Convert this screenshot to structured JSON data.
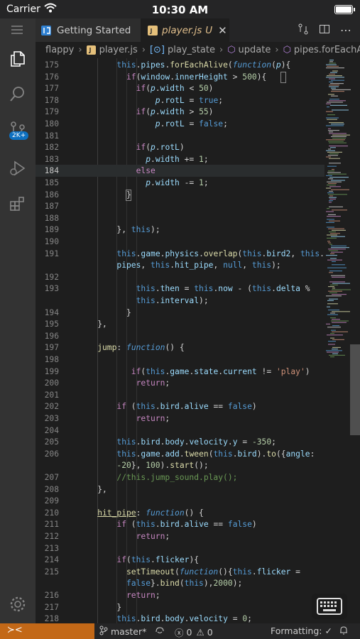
{
  "ios_status": {
    "carrier": "Carrier",
    "time": "10:30 AM"
  },
  "activity": {
    "scm_badge": "2K+"
  },
  "tabs": [
    {
      "label": "Getting Started"
    },
    {
      "label": "player.js",
      "status": "U"
    }
  ],
  "breadcrumb": [
    "flappy",
    "player.js",
    "play_state",
    "update",
    "pipes.forEachAlive()"
  ],
  "status": {
    "branch": "master*",
    "errors": "0",
    "warnings": "0",
    "formatting": "Formatting:"
  },
  "code_lines": [
    {
      "n": "175",
      "h": "<span class=\"k\">this</span><span class=\"t\">.</span><span class=\"p\">pipes</span><span class=\"t\">.</span><span class=\"f\">forEachAlive</span><span class=\"t\">(</span><span class=\"fn\">function</span><span class=\"t\">(</span><span class=\"pm\">p</span><span class=\"t\">){</span>",
      "i": 8
    },
    {
      "n": "176",
      "h": "<span class=\"ctrl\">if</span><span class=\"t\">(</span><span class=\"p\">window</span><span class=\"t\">.</span><span class=\"p\">innerHeight</span><span class=\"t\"> &gt; </span><span class=\"n\">500</span><span class=\"t\">){</span>",
      "i": 10
    },
    {
      "n": "177",
      "h": "<span class=\"ctrl\">if</span><span class=\"t\">(</span><span class=\"pm\">p</span><span class=\"t\">.</span><span class=\"p\">width</span><span class=\"t\"> &lt; </span><span class=\"n\">50</span><span class=\"t\">)</span>",
      "i": 12
    },
    {
      "n": "178",
      "h": "<span class=\"pm\">p</span><span class=\"t\">.</span><span class=\"p\">rotL</span><span class=\"t\"> = </span><span class=\"k\">true</span><span class=\"t\">;</span>",
      "i": 16
    },
    {
      "n": "179",
      "h": "<span class=\"ctrl\">if</span><span class=\"t\">(</span><span class=\"pm\">p</span><span class=\"t\">.</span><span class=\"p\">width</span><span class=\"t\"> &gt; </span><span class=\"n\">55</span><span class=\"t\">)</span>",
      "i": 12
    },
    {
      "n": "180",
      "h": "<span class=\"pm\">p</span><span class=\"t\">.</span><span class=\"p\">rotL</span><span class=\"t\"> = </span><span class=\"k\">false</span><span class=\"t\">;</span>",
      "i": 16
    },
    {
      "n": "181",
      "h": "",
      "i": 0
    },
    {
      "n": "182",
      "h": "<span class=\"ctrl\">if</span><span class=\"t\">(</span><span class=\"pm\">p</span><span class=\"t\">.</span><span class=\"p\">rotL</span><span class=\"t\">)</span>",
      "i": 12
    },
    {
      "n": "183",
      "h": "<span class=\"pm\">p</span><span class=\"t\">.</span><span class=\"p\">width</span><span class=\"t\"> += </span><span class=\"n\">1</span><span class=\"t\">;</span>",
      "i": 14
    },
    {
      "n": "184",
      "h": "<span class=\"ctrl\">else</span>",
      "i": 12,
      "cur": true
    },
    {
      "n": "185",
      "h": "<span class=\"pm\">p</span><span class=\"t\">.</span><span class=\"p\">width</span><span class=\"t\"> -= </span><span class=\"n\">1</span><span class=\"t\">;</span>",
      "i": 14
    },
    {
      "n": "186",
      "h": "<span class=\"t\">}</span>",
      "i": 10
    },
    {
      "n": "187",
      "h": "",
      "i": 0
    },
    {
      "n": "188",
      "h": "",
      "i": 0
    },
    {
      "n": "189",
      "h": "<span class=\"t\">}, </span><span class=\"k\">this</span><span class=\"t\">);</span>",
      "i": 8
    },
    {
      "n": "190",
      "h": "",
      "i": 0
    },
    {
      "n": "191",
      "h": "<span class=\"k\">this</span><span class=\"t\">.</span><span class=\"p\">game</span><span class=\"t\">.</span><span class=\"p\">physics</span><span class=\"t\">.</span><span class=\"f\">overlap</span><span class=\"t\">(</span><span class=\"k\">this</span><span class=\"t\">.</span><span class=\"p\">bird2</span><span class=\"t\">, </span><span class=\"k\">this</span><span class=\"t\">.</span>",
      "i": 8
    },
    {
      "n": "",
      "h": "<span class=\"p\">pipes</span><span class=\"t\">, </span><span class=\"k\">this</span><span class=\"t\">.</span><span class=\"p\">hit_pipe</span><span class=\"t\">, </span><span class=\"k\">null</span><span class=\"t\">, </span><span class=\"k\">this</span><span class=\"t\">);</span>",
      "i": 8
    },
    {
      "n": "192",
      "h": "",
      "i": 0
    },
    {
      "n": "193",
      "h": "<span class=\"k\">this</span><span class=\"t\">.</span><span class=\"p\">then</span><span class=\"t\"> = </span><span class=\"k\">this</span><span class=\"t\">.</span><span class=\"p\">now</span><span class=\"t\"> - (</span><span class=\"k\">this</span><span class=\"t\">.</span><span class=\"p\">delta</span><span class=\"t\"> % </span>",
      "i": 12
    },
    {
      "n": "",
      "h": "<span class=\"k\">this</span><span class=\"t\">.</span><span class=\"p\">interval</span><span class=\"t\">);</span>",
      "i": 12
    },
    {
      "n": "194",
      "h": "<span class=\"t\">}</span>",
      "i": 10
    },
    {
      "n": "195",
      "h": "<span class=\"t\">},</span>",
      "i": 4
    },
    {
      "n": "196",
      "h": "",
      "i": 0
    },
    {
      "n": "197",
      "h": "<span class=\"f\">jump</span><span class=\"t\">: </span><span class=\"fn\">function</span><span class=\"t\">() {</span>",
      "i": 4
    },
    {
      "n": "198",
      "h": "",
      "i": 0
    },
    {
      "n": "199",
      "h": "<span class=\"ctrl\">if</span><span class=\"t\">(</span><span class=\"k\">this</span><span class=\"t\">.</span><span class=\"p\">game</span><span class=\"t\">.</span><span class=\"p\">state</span><span class=\"t\">.</span><span class=\"p\">current</span><span class=\"t\"> != </span><span class=\"s\">'play'</span><span class=\"t\">)</span>",
      "i": 11
    },
    {
      "n": "200",
      "h": "<span class=\"ctrl\">return</span><span class=\"t\">;</span>",
      "i": 12
    },
    {
      "n": "201",
      "h": "",
      "i": 0
    },
    {
      "n": "202",
      "h": "<span class=\"ctrl\">if</span><span class=\"t\"> (</span><span class=\"k\">this</span><span class=\"t\">.</span><span class=\"p\">bird</span><span class=\"t\">.</span><span class=\"p\">alive</span><span class=\"t\"> == </span><span class=\"k\">false</span><span class=\"t\">)</span>",
      "i": 8
    },
    {
      "n": "203",
      "h": "<span class=\"ctrl\">return</span><span class=\"t\">;</span>",
      "i": 12
    },
    {
      "n": "204",
      "h": "",
      "i": 0
    },
    {
      "n": "205",
      "h": "<span class=\"k\">this</span><span class=\"t\">.</span><span class=\"p\">bird</span><span class=\"t\">.</span><span class=\"p\">body</span><span class=\"t\">.</span><span class=\"p\">velocity</span><span class=\"t\">.</span><span class=\"p\">y</span><span class=\"t\"> = </span><span class=\"n\">-350</span><span class=\"t\">;</span>",
      "i": 8
    },
    {
      "n": "206",
      "h": "<span class=\"k\">this</span><span class=\"t\">.</span><span class=\"p\">game</span><span class=\"t\">.</span><span class=\"p\">add</span><span class=\"t\">.</span><span class=\"f\">tween</span><span class=\"t\">(</span><span class=\"k\">this</span><span class=\"t\">.</span><span class=\"p\">bird</span><span class=\"t\">).</span><span class=\"f\">to</span><span class=\"t\">({</span><span class=\"p\">angle</span><span class=\"t\">:</span>",
      "i": 8
    },
    {
      "n": "",
      "h": "<span class=\"n\">-20</span><span class=\"t\">}, </span><span class=\"n\">100</span><span class=\"t\">).</span><span class=\"f\">start</span><span class=\"t\">();</span>",
      "i": 8
    },
    {
      "n": "207",
      "h": "<span class=\"c\">//this.jump_sound.play();</span>",
      "i": 8
    },
    {
      "n": "208",
      "h": "<span class=\"t\">},</span>",
      "i": 4
    },
    {
      "n": "209",
      "h": "",
      "i": 0
    },
    {
      "n": "210",
      "h": "<span class=\"f\" style=\"text-decoration:underline;\">hit_pipe</span><span class=\"t\">: </span><span class=\"fn\">function</span><span class=\"t\">() {</span>",
      "i": 4
    },
    {
      "n": "211",
      "h": "<span class=\"ctrl\">if</span><span class=\"t\"> (</span><span class=\"k\">this</span><span class=\"t\">.</span><span class=\"p\">bird</span><span class=\"t\">.</span><span class=\"p\">alive</span><span class=\"t\"> == </span><span class=\"k\">false</span><span class=\"t\">)</span>",
      "i": 8
    },
    {
      "n": "212",
      "h": "<span class=\"ctrl\">return</span><span class=\"t\">;</span>",
      "i": 12
    },
    {
      "n": "213",
      "h": "",
      "i": 0
    },
    {
      "n": "214",
      "h": "<span class=\"ctrl\">if</span><span class=\"t\">(</span><span class=\"k\">this</span><span class=\"t\">.</span><span class=\"p\">flicker</span><span class=\"t\">){</span>",
      "i": 8
    },
    {
      "n": "215",
      "h": "<span class=\"f\">setTimeout</span><span class=\"t\">(</span><span class=\"fn\">function</span><span class=\"t\">(){</span><span class=\"k\">this</span><span class=\"t\">.</span><span class=\"p\">flicker</span><span class=\"t\"> =</span>",
      "i": 10
    },
    {
      "n": "",
      "h": "<span class=\"k\">false</span><span class=\"t\">}.</span><span class=\"f\">bind</span><span class=\"t\">(</span><span class=\"k\">this</span><span class=\"t\">),</span><span class=\"n\">2000</span><span class=\"t\">);</span>",
      "i": 10
    },
    {
      "n": "216",
      "h": "<span class=\"ctrl\">return</span><span class=\"t\">;</span>",
      "i": 10
    },
    {
      "n": "217",
      "h": "<span class=\"t\">}</span>",
      "i": 8
    },
    {
      "n": "218",
      "h": "<span class=\"k\">this</span><span class=\"t\">.</span><span class=\"p\">bird</span><span class=\"t\">.</span><span class=\"p\">body</span><span class=\"t\">.</span><span class=\"p\">velocity</span><span class=\"t\"> = </span><span class=\"n\">0</span><span class=\"t\">;</span>",
      "i": 8
    }
  ]
}
